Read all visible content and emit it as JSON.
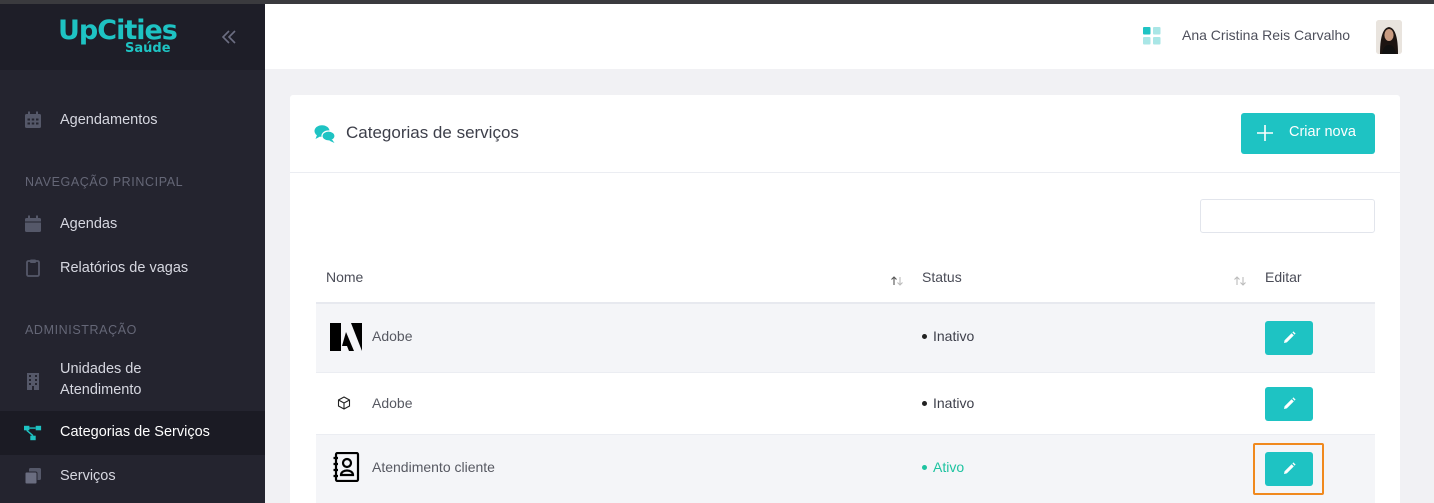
{
  "brand": {
    "name": "UpCities",
    "sub": "Saúde"
  },
  "sidebar": {
    "items": [
      {
        "label": "Agendamentos"
      },
      {
        "label": "Agendas"
      },
      {
        "label": "Relatórios de vagas"
      },
      {
        "label": "Unidades de Atendimento"
      },
      {
        "label": "Categorias de Serviços"
      },
      {
        "label": "Serviços"
      }
    ],
    "sections": [
      {
        "title": "NAVEGAÇÃO PRINCIPAL"
      },
      {
        "title": "ADMINISTRAÇÃO"
      }
    ],
    "active_label": "Categorias de Serviços"
  },
  "header": {
    "user_name": "Ana Cristina Reis Carvalho"
  },
  "page": {
    "title": "Categorias de serviços",
    "create_button": "Criar nova",
    "search_value": ""
  },
  "table": {
    "columns": [
      "Nome",
      "Status",
      "Editar"
    ],
    "rows": [
      {
        "icon": "adobe-logo-icon",
        "name": "Adobe",
        "status": "Inativo"
      },
      {
        "icon": "cube-icon",
        "name": "Adobe",
        "status": "Inativo"
      },
      {
        "icon": "contact-book-icon",
        "name": "Atendimento cliente",
        "status": "Ativo"
      }
    ]
  },
  "colors": {
    "accent": "#1ec3c3",
    "sidebar": "#24242f",
    "focus": "#f0891e"
  }
}
